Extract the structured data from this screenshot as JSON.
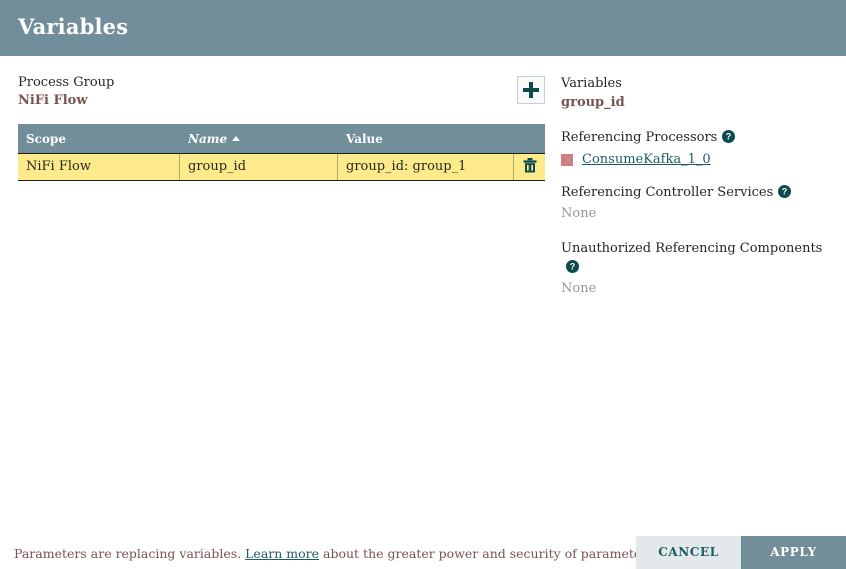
{
  "dialog": {
    "title": "Variables"
  },
  "process_group": {
    "label": "Process Group",
    "name": "NiFi Flow"
  },
  "toolbar": {
    "add_icon": "plus-icon",
    "add_title": "Add variable"
  },
  "table": {
    "columns": [
      {
        "key": "scope",
        "label": "Scope",
        "sorted": false
      },
      {
        "key": "name",
        "label": "Name",
        "sorted": true,
        "sort_direction": "asc"
      },
      {
        "key": "value",
        "label": "Value",
        "sorted": false
      }
    ],
    "rows": [
      {
        "scope": "NiFi Flow",
        "name": "group_id",
        "value": "group_id: group_1",
        "delete_icon": "trash-icon",
        "selected": true
      }
    ]
  },
  "info_panel": {
    "variables_label": "Variables",
    "variable_name": "group_id",
    "referencing_processors": {
      "heading": "Referencing Processors",
      "help_icon": "help-icon",
      "items": [
        {
          "name": "ConsumeKafka_1_0",
          "swatch_color": "#cc8282"
        }
      ]
    },
    "referencing_controller_services": {
      "heading": "Referencing Controller Services",
      "help_icon": "help-icon",
      "empty_text": "None"
    },
    "unauthorized_referencing_components": {
      "heading": "Unauthorized Referencing Components",
      "help_icon": "help-icon",
      "empty_text": "None"
    }
  },
  "footer": {
    "note_prefix": "Parameters are replacing variables.",
    "note_link": "Learn more",
    "note_suffix": "about the greater power and security of parameters.",
    "cancel_label": "CANCEL",
    "apply_label": "APPLY"
  },
  "colors": {
    "header_bar": "#728e9b",
    "selected_row": "#fdeb8b",
    "accent_text": "#775351",
    "link_teal": "#1b5e62",
    "swatch_rose": "#cc8282",
    "muted_text": "#969696"
  }
}
